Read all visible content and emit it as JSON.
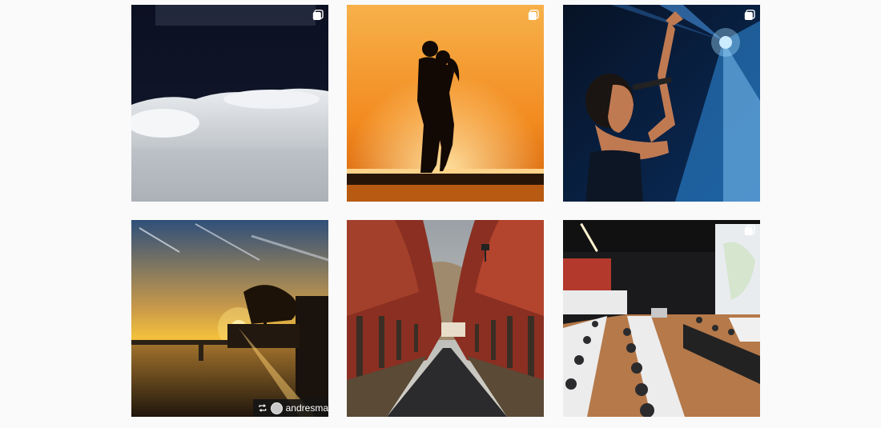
{
  "grid": {
    "tiles": [
      {
        "id": "snow",
        "multi": true
      },
      {
        "id": "couple-sunset",
        "multi": true
      },
      {
        "id": "singer-stage",
        "multi": true
      },
      {
        "id": "river-sunset",
        "multi": false,
        "repost": {
          "username": "andresma"
        }
      },
      {
        "id": "autumn-avenue",
        "multi": false
      },
      {
        "id": "conference-hall",
        "multi": true
      }
    ]
  },
  "icons": {
    "multi": "multiple-images-icon",
    "repost": "repost-icon"
  },
  "colors": {
    "page_background": "#fafafa",
    "overlay_text": "#ffffff"
  }
}
